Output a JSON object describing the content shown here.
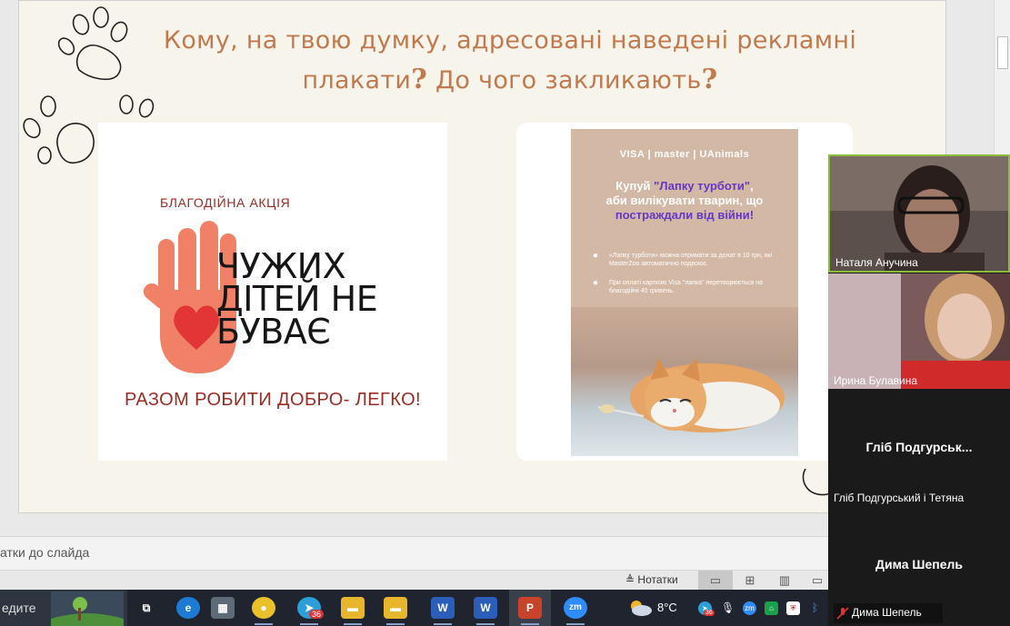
{
  "slide": {
    "title_line1": "Кому, на твою думку, адресовані наведені рекламні",
    "title_line2": "плакати",
    "title_line2b": " До чого закликають",
    "qmark": "?"
  },
  "poster1": {
    "small": "БЛАГОДІЙНА АКЦІЯ",
    "big_line1": "ЧУЖИХ",
    "big_line2": "ДІТЕЙ НЕ",
    "big_line3": "БУВАЄ",
    "bottom": "РАЗОМ РОБИТИ ДОБРО- ЛЕГКО!"
  },
  "poster2": {
    "logos": "VISA  |  master  |  UAnimals",
    "head_line1_a": "Купуй ",
    "head_line1_b": "\"Лапку турботи\"",
    "head_line1_c": ",",
    "head_line2": "аби вилікувати тварин, що",
    "head_line3": "постраждали від війни!",
    "bullet1": "«Лапку турботи» можна отримати за донат в 10 грн, які MasterZoo автоматично подвоює.",
    "bullet2": "При оплаті карткою Visa \"лапка\" перетворюється на благодійні 40 гривень."
  },
  "video": {
    "p1_name": "Наталя Анучина",
    "p2_name": "Ирина Булавина",
    "p3_center": "Гліб  Подгурськ...",
    "p3_name": "Гліб Подгурський і Тетяна",
    "p4_center": "Дима Шепель",
    "p4_name": "Дима Шепель"
  },
  "notes": {
    "placeholder": "атки до слайда"
  },
  "status": {
    "notes_label": "Нотатки"
  },
  "taskbar": {
    "search_text": "едите",
    "temperature": "8°C",
    "telegram_badge": "36",
    "sys_badge": "36"
  },
  "colors": {
    "title": "#c27a4d",
    "slide_bg": "#f7f4ec",
    "poster_red": "#9a2b25",
    "poster2_bg": "#d4b8a6",
    "violet": "#6338c7",
    "taskbar": "#20242e"
  }
}
